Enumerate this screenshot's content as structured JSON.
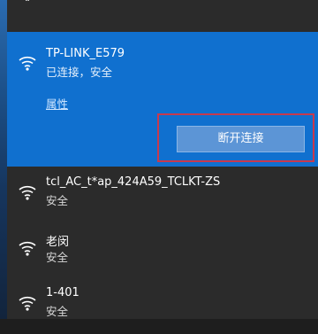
{
  "window": {
    "top_glyph": "¨"
  },
  "networks": [
    {
      "name": "TP-LINK_E579",
      "status": "已连接，安全",
      "properties_label": "属性",
      "action_button": "断开连接"
    },
    {
      "name": "tcl_AC_t*ap_424A59_TCLKT-ZS",
      "status": "安全"
    },
    {
      "name": "老闵",
      "status": "安全"
    },
    {
      "name": "1-401",
      "status": "安全"
    }
  ],
  "colors": {
    "panel_bg": "#2b2b2b",
    "selected_bg": "#1070cf",
    "button_bg": "#5c95d6",
    "highlight_border": "#c83a4e"
  },
  "icons": {
    "network": "wifi-signal-icon"
  }
}
